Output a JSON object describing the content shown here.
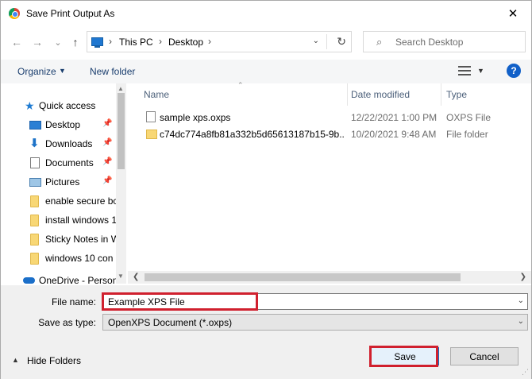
{
  "window": {
    "title": "Save Print Output As",
    "close_glyph": "✕"
  },
  "address": {
    "crumbs": [
      "This PC",
      "Desktop"
    ],
    "separator": "›",
    "dropdown_glyph": "⌄",
    "refresh_glyph": "↻"
  },
  "nav_buttons": {
    "back": "←",
    "forward": "→",
    "recent": "⌄",
    "up": "↑"
  },
  "search": {
    "placeholder": "Search Desktop",
    "icon_glyph": "⌕"
  },
  "toolbar": {
    "organize_label": "Organize",
    "caret": "▼",
    "new_folder_label": "New folder",
    "help_glyph": "?"
  },
  "sidebar": {
    "items": [
      {
        "label": "Quick access",
        "icon": "star-icon",
        "pinned": false
      },
      {
        "label": "Desktop",
        "icon": "desktop-folder-icon",
        "pinned": true
      },
      {
        "label": "Downloads",
        "icon": "download-icon",
        "pinned": true
      },
      {
        "label": "Documents",
        "icon": "documents-icon",
        "pinned": true
      },
      {
        "label": "Pictures",
        "icon": "pictures-icon",
        "pinned": true
      },
      {
        "label": "enable secure bc",
        "icon": "folder-icon",
        "pinned": false
      },
      {
        "label": "install windows 1",
        "icon": "folder-icon",
        "pinned": false
      },
      {
        "label": "Sticky Notes in W",
        "icon": "folder-icon",
        "pinned": false
      },
      {
        "label": "windows 10 con",
        "icon": "folder-icon",
        "pinned": false
      },
      {
        "label": "OneDrive - Person",
        "icon": "onedrive-icon",
        "pinned": false
      }
    ],
    "pin_glyph": "📌"
  },
  "filelist": {
    "columns": {
      "name": "Name",
      "date": "Date modified",
      "type": "Type"
    },
    "sort_glyph": "⌃",
    "rows": [
      {
        "name": "sample xps.oxps",
        "date": "12/22/2021 1:00 PM",
        "type": "OXPS File",
        "icon": "file-icon"
      },
      {
        "name": "c74dc774a8fb81a332b5d65613187b15-9b...",
        "date": "10/20/2021 9:48 AM",
        "type": "File folder",
        "icon": "folder-icon"
      }
    ]
  },
  "scroll": {
    "up": "▲",
    "down": "▼",
    "left": "❮",
    "right": "❯"
  },
  "form": {
    "filename_label": "File name:",
    "filename_value": "Example XPS File",
    "savetype_label": "Save as type:",
    "savetype_value": "OpenXPS Document (*.oxps)",
    "dropdown_glyph": "⌄"
  },
  "footer": {
    "hide_folders_label": "Hide Folders",
    "hide_caret": "▲",
    "save_label": "Save",
    "cancel_label": "Cancel",
    "grip_glyph": "⋰"
  },
  "colors": {
    "highlight": "#d0202e",
    "accent": "#0078d7",
    "toolbar_bg": "#f5f6f7",
    "panel_bg": "#f0f0f0"
  }
}
